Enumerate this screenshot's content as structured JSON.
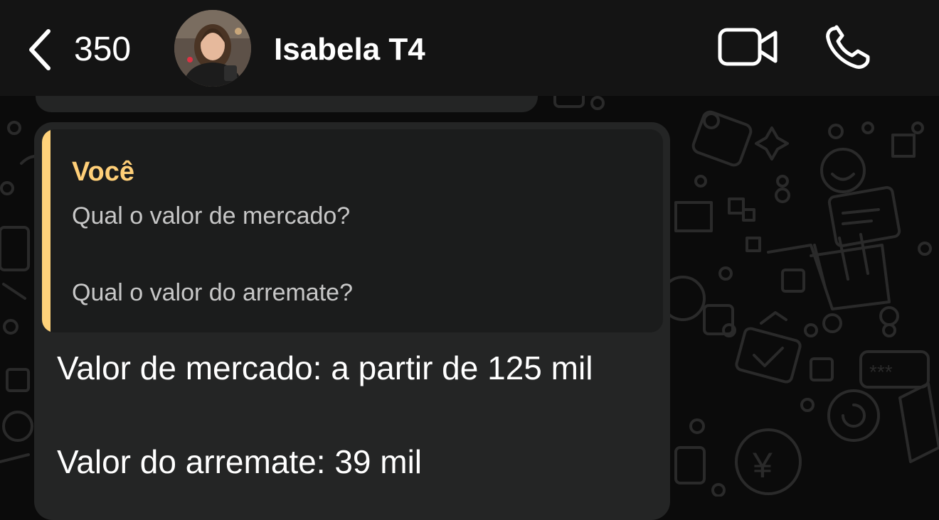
{
  "header": {
    "unread_count": "350",
    "contact_name": "Isabela T4"
  },
  "quoted": {
    "author": "Você",
    "line1": "Qual o valor de mercado?",
    "line2": "Qual o valor do arremate?"
  },
  "message": {
    "line1": "Valor de mercado: a partir de 125 mil",
    "line2": "Valor do arremate: 39 mil"
  },
  "colors": {
    "header_bg": "#141414",
    "bubble_bg": "#242525",
    "quote_bg": "#1b1c1c",
    "quote_accent": "#ffd27a"
  },
  "icons": {
    "back": "chevron-left-icon",
    "video": "video-camera-icon",
    "call": "phone-icon"
  }
}
